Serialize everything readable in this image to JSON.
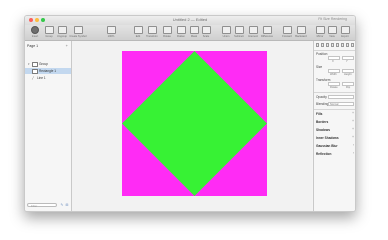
{
  "window": {
    "title": "Untitled 2 — Edited",
    "right_label": "Fit Size Rendering"
  },
  "toolbar": {
    "items": [
      {
        "id": "insert",
        "label": "Insert"
      },
      {
        "id": "group",
        "label": "Group"
      },
      {
        "id": "ungroup",
        "label": "Ungroup"
      },
      {
        "id": "create_symbol",
        "label": "Create Symbol"
      },
      {
        "id": "zoom",
        "label": "100%"
      },
      {
        "id": "edit",
        "label": "Edit"
      },
      {
        "id": "transform",
        "label": "Transform"
      },
      {
        "id": "rotate",
        "label": "Rotate"
      },
      {
        "id": "flatten",
        "label": "Flatten"
      },
      {
        "id": "mask",
        "label": "Mask"
      },
      {
        "id": "scale",
        "label": "Scale"
      },
      {
        "id": "union",
        "label": "Union"
      },
      {
        "id": "subtract",
        "label": "Subtract"
      },
      {
        "id": "intersect",
        "label": "Intersect"
      },
      {
        "id": "difference",
        "label": "Difference"
      },
      {
        "id": "forward",
        "label": "Forward"
      },
      {
        "id": "backward",
        "label": "Backward"
      },
      {
        "id": "mirror",
        "label": "Mirror"
      },
      {
        "id": "view",
        "label": "View"
      },
      {
        "id": "export",
        "label": "Export"
      }
    ]
  },
  "layers": {
    "page_label": "Page 1",
    "items": [
      {
        "label": "Group",
        "type": "group",
        "selected": false
      },
      {
        "label": "Rectangle 1",
        "type": "rectangle",
        "selected": true
      },
      {
        "label": "Line 1",
        "type": "line",
        "selected": false
      }
    ],
    "filter_placeholder": "Filter"
  },
  "canvas": {
    "background_color": "#f2f2f2",
    "rectangle_color": "#ff2bf5",
    "diamond_color": "#37f234"
  },
  "inspector": {
    "position_label": "Position",
    "position_sub_x": "X",
    "position_sub_y": "Y",
    "size_label": "Size",
    "size_sub_w": "Width",
    "size_sub_h": "Height",
    "transform_label": "Transform",
    "transform_sub_rotate": "Rotate",
    "transform_sub_flip": "Flip",
    "opacity_label": "Opacity",
    "blending_label": "Blending",
    "blending_value": "Normal",
    "sections": [
      "Fills",
      "Borders",
      "Shadows",
      "Inner Shadows",
      "Gaussian Blur",
      "Reflection"
    ]
  }
}
